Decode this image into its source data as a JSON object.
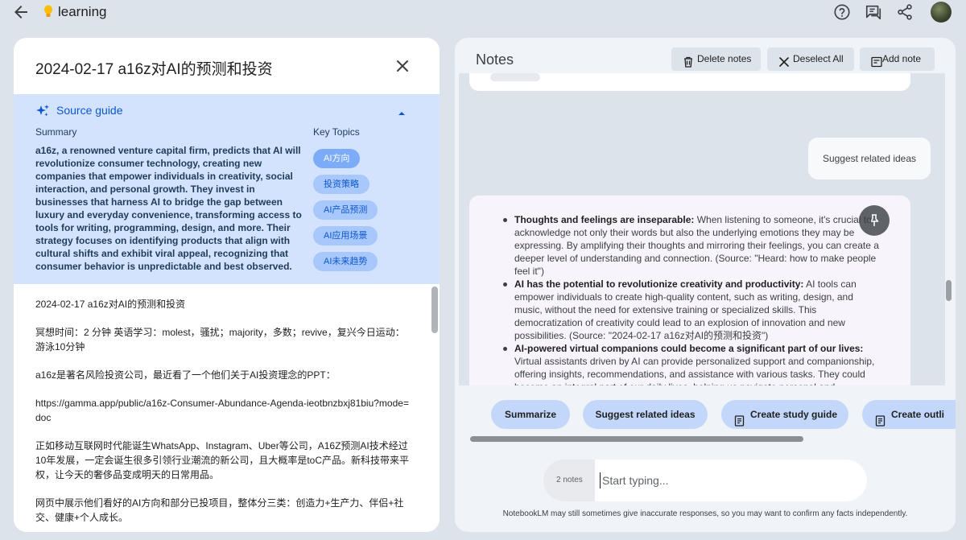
{
  "topbar": {
    "app_title": "learning",
    "icons": [
      "back-arrow-icon",
      "lightbulb-icon",
      "help-icon",
      "chat-icon",
      "share-icon",
      "avatar"
    ]
  },
  "source": {
    "title": "2024-02-17 a16z对AI的预测和投资",
    "guide_label": "Source guide",
    "summary_label": "Summary",
    "summary_text": "a16z, a renowned venture capital firm, predicts that AI will revolutionize consumer technology, creating new companies that empower individuals in creativity, social interaction, and personal growth. They invest in businesses that harness AI to bridge the gap between luxury and everyday convenience, transforming access to tools for writing, programming, design, and more. Their strategy focuses on identifying products that align with cultural shifts and exhibit viral appeal, recognizing that consumer behavior is unpredictable and best observed.",
    "topics_label": "Key Topics",
    "topics": [
      "AI方向",
      "投资策略",
      "AI产品预测",
      "AI应用场景",
      "AI未来趋势"
    ],
    "body": [
      "2024-02-17 a16z对AI的预测和投资",
      "冥想时间：2 分钟 英语学习：molest，骚扰；majority，多数；revive，复兴今日运动：游泳10分钟",
      "a16z是著名风险投资公司，最近看了一个他们关于AI投资理念的PPT：",
      "https://gamma.app/public/a16z-Consumer-Abundance-Agenda-ieotbnzbxj81biu?mode=doc",
      "正如移动互联网时代能诞生WhatsApp、Instagram、Uber等公司，A16Z预测AI技术经过10年发展，一定会诞生很多引领行业潮流的新公司，且大概率是toC产品。新科技带来平权，让今天的奢侈品变成明天的日常用品。",
      "网页中展示他们看好的AI方向和部分已投项目，整体分三类：创造力+生产力、伴侣+社交、健康+个人成长。"
    ]
  },
  "notes": {
    "title": "Notes",
    "delete_label": "Delete notes",
    "deselect_label": "Deselect All",
    "add_label": "Add note",
    "suggest_bubble": "Suggest related ideas",
    "items": [
      {
        "head": "Thoughts and feelings are inseparable:",
        "text": " When listening to someone, it's crucial to acknowledge not only their words but also the underlying emotions they may be expressing. By amplifying their thoughts and mirroring their feelings, you can create a deeper level of understanding and connection. (Source: \"Heard: how to make people feel it\")"
      },
      {
        "head": "AI has the potential to revolutionize creativity and productivity:",
        "text": " AI tools can empower individuals to create high-quality content, such as writing, design, and music, without the need for extensive training or specialized skills. This democratization of creativity could lead to an explosion of innovation and new possibilities. (Source: \"2024-02-17 a16z对AI的预测和投资\")"
      },
      {
        "head": "AI-powered virtual companions could become a significant part of our lives:",
        "text": " Virtual assistants driven by AI can provide personalized support and companionship, offering insights, recommendations, and assistance with various tasks. They could become an integral part of our daily lives, helping us navigate personal and professional challenges more effectively. (Source: \"2024-02-17 a16z对AI的预测和投资\")"
      }
    ],
    "actions": [
      "Summarize",
      "Suggest related ideas",
      "Create study guide",
      "Create outli"
    ],
    "notes_count": "2 notes",
    "input_placeholder": "Start typing...",
    "disclaimer": "NotebookLM may still sometimes give inaccurate responses, so you may want to confirm any facts independently."
  }
}
